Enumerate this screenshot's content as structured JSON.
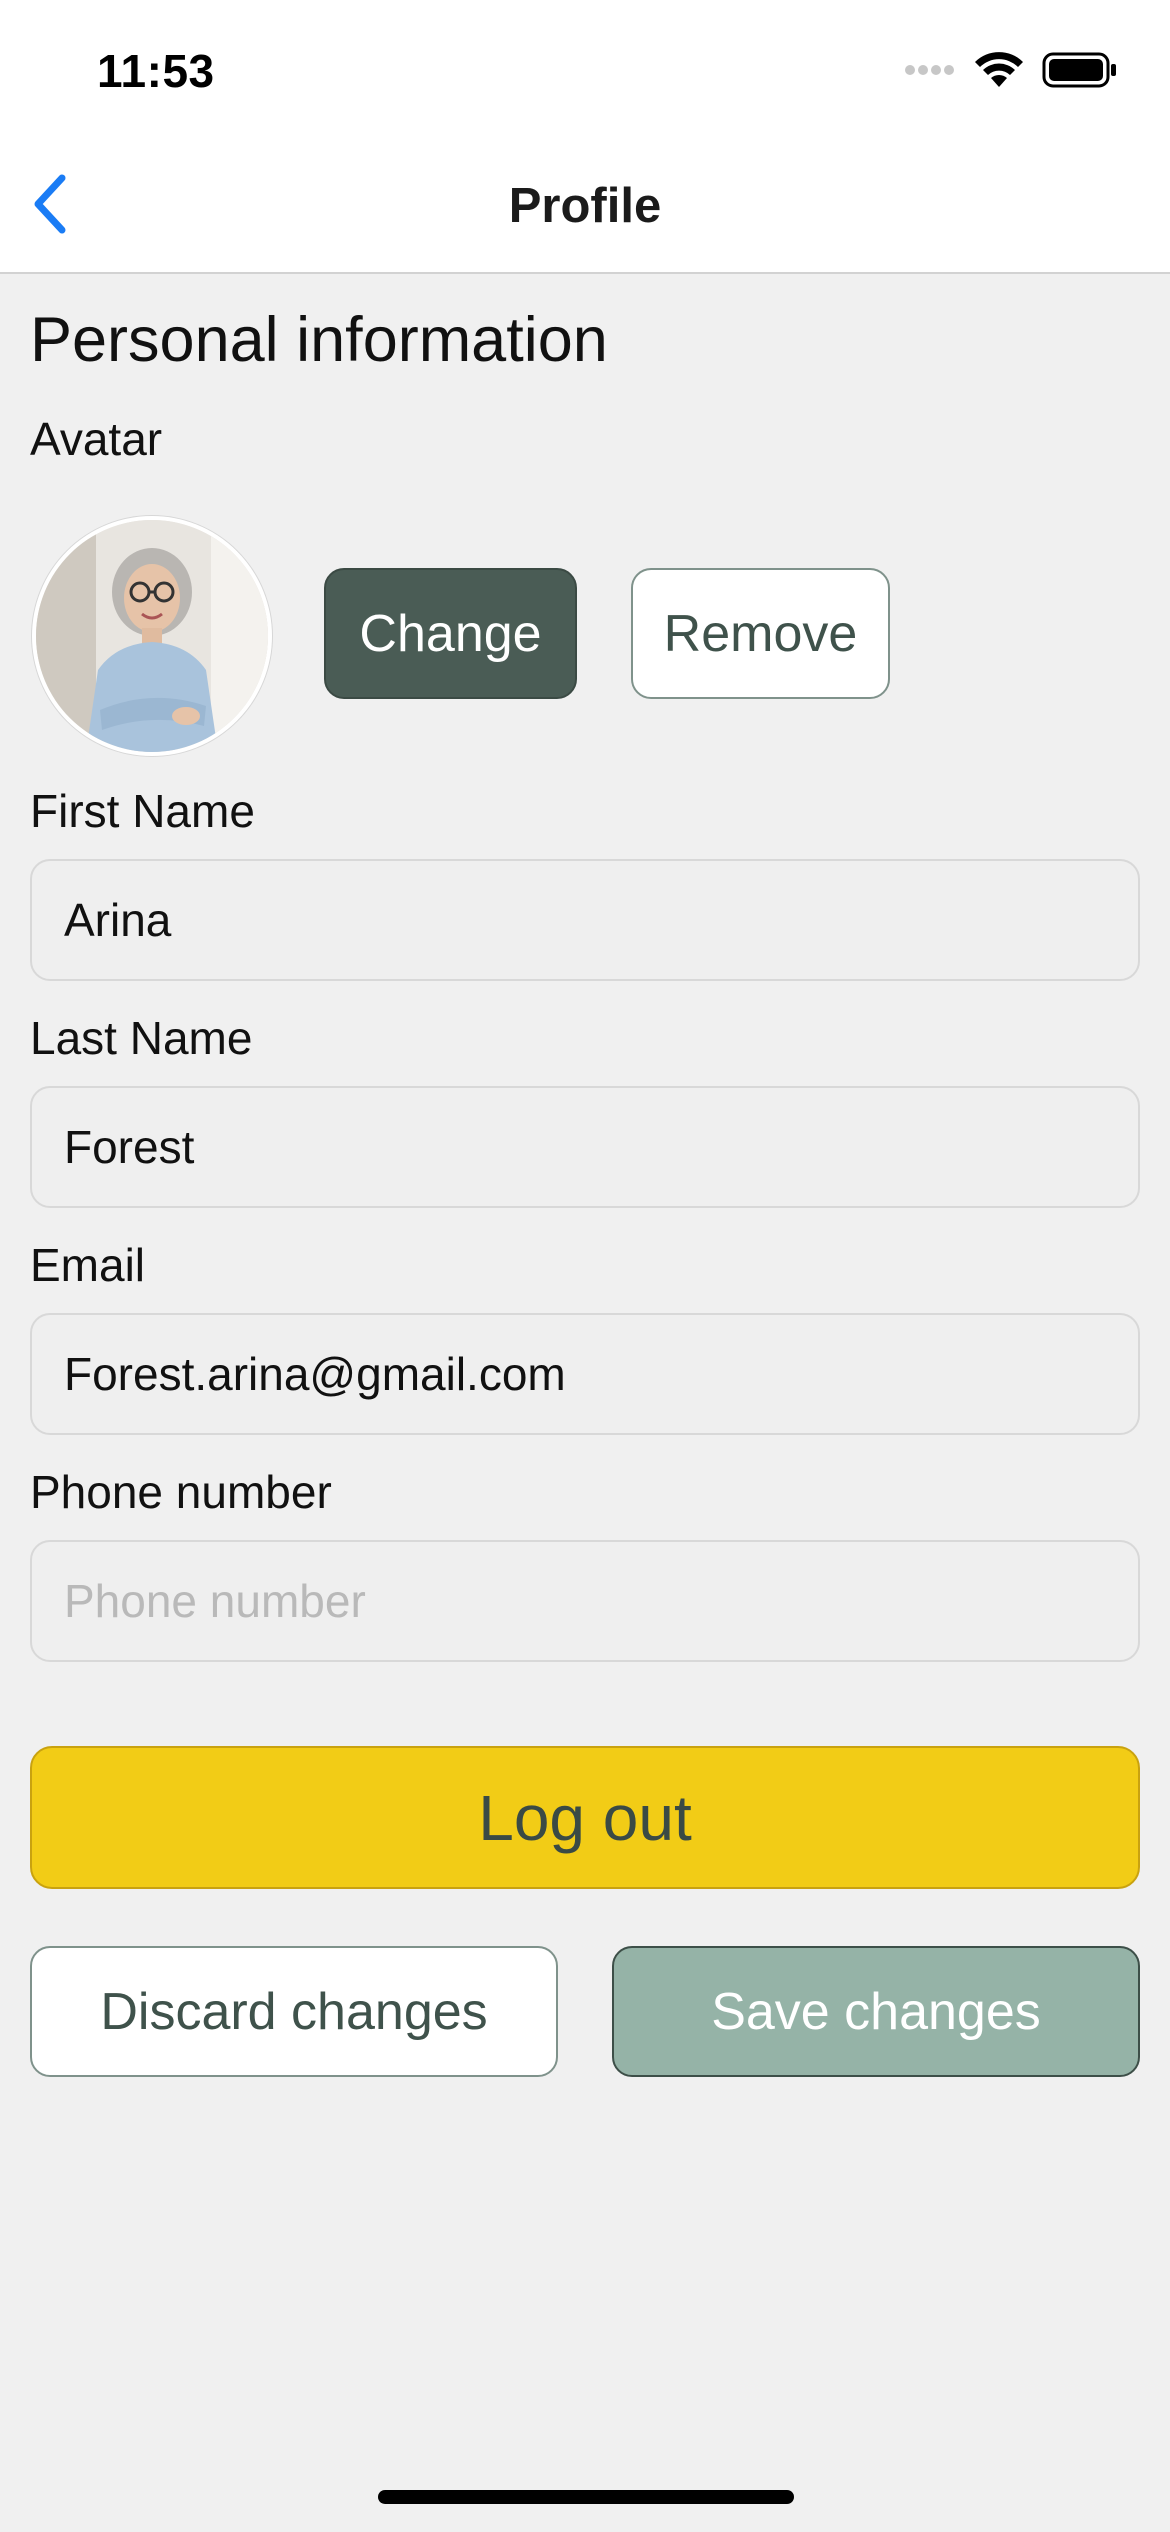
{
  "status_bar": {
    "time": "11:53"
  },
  "nav": {
    "title": "Profile"
  },
  "section": {
    "title": "Personal information"
  },
  "avatar": {
    "label": "Avatar",
    "change_label": "Change",
    "remove_label": "Remove"
  },
  "fields": {
    "first_name": {
      "label": "First Name",
      "value": "Arina"
    },
    "last_name": {
      "label": "Last Name",
      "value": "Forest"
    },
    "email": {
      "label": "Email",
      "value": "Forest.arina@gmail.com"
    },
    "phone": {
      "label": "Phone number",
      "value": "",
      "placeholder": "Phone number"
    }
  },
  "actions": {
    "logout_label": "Log out",
    "discard_label": "Discard changes",
    "save_label": "Save changes"
  },
  "colors": {
    "accent_blue": "#1a7cf5",
    "change_button": "#4a5c55",
    "logout_button": "#f2cc16",
    "save_button": "#95b3a7",
    "background": "#f0f0f0"
  }
}
